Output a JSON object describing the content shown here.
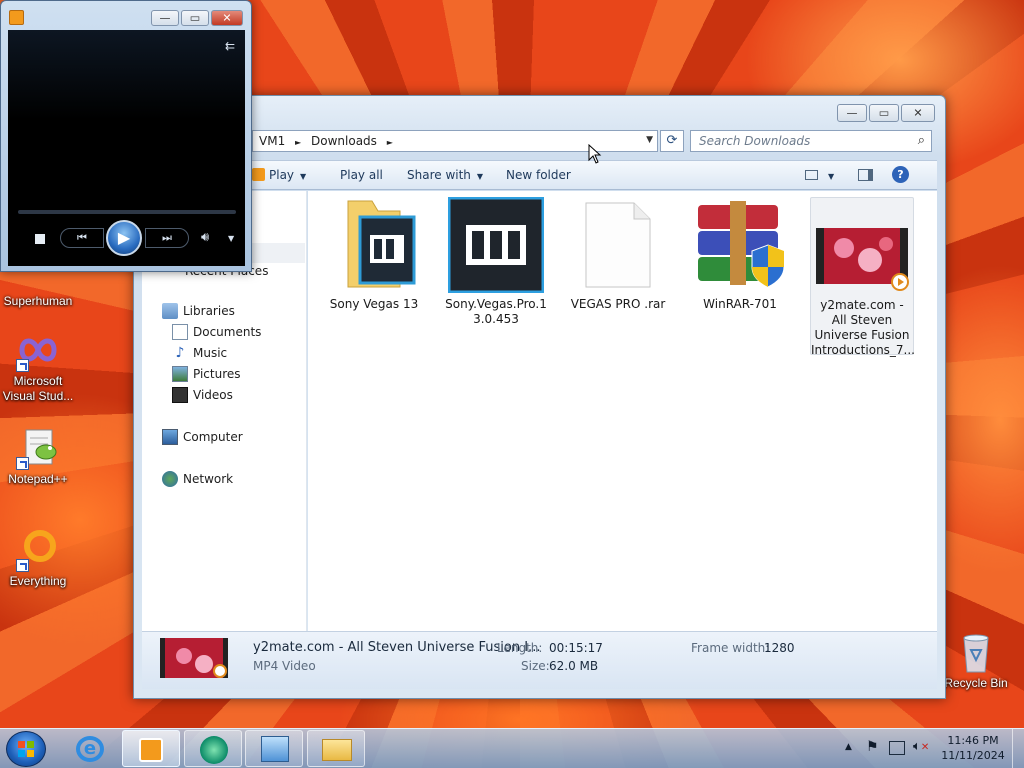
{
  "desktop": {
    "icons": [
      {
        "label": "Superhuman"
      },
      {
        "label": "Microsoft Visual Stud..."
      },
      {
        "label": "Notepad++"
      },
      {
        "label": "Everything"
      },
      {
        "label": "Recycle Bin"
      }
    ]
  },
  "explorer": {
    "address": {
      "crumb1": "VM1",
      "sep": "►",
      "crumb2": "Downloads",
      "sep2": "►"
    },
    "search": {
      "placeholder": "Search Downloads"
    },
    "toolbar": {
      "play": "Play",
      "play_all": "Play all",
      "share_with": "Share with",
      "new_folder": "New folder"
    },
    "nav": {
      "recent_places": "Recent Places",
      "libraries": "Libraries",
      "documents": "Documents",
      "music": "Music",
      "pictures": "Pictures",
      "videos": "Videos",
      "computer": "Computer",
      "network": "Network"
    },
    "files": [
      {
        "name": "Sony Vegas 13"
      },
      {
        "name": "Sony.Vegas.Pro.1 3.0.453"
      },
      {
        "name": "VEGAS PRO .rar"
      },
      {
        "name": "WinRAR-701"
      },
      {
        "name": "y2mate.com - All Steven Universe Fusion Introductions_7..."
      }
    ],
    "details": {
      "filename": "y2mate.com - All Steven Universe Fusion I...",
      "type": "MP4 Video",
      "length_label": "Length:",
      "length": "00:15:17",
      "size_label": "Size:",
      "size": "62.0 MB",
      "frame_width_label": "Frame width:",
      "frame_width": "1280"
    }
  },
  "taskbar": {
    "time": "11:46 PM",
    "date": "11/11/2024"
  },
  "colors": {
    "accent": "#2a5bc9",
    "selected_bg": "#f0f2f5",
    "toolbar_text": "#1e395b"
  }
}
